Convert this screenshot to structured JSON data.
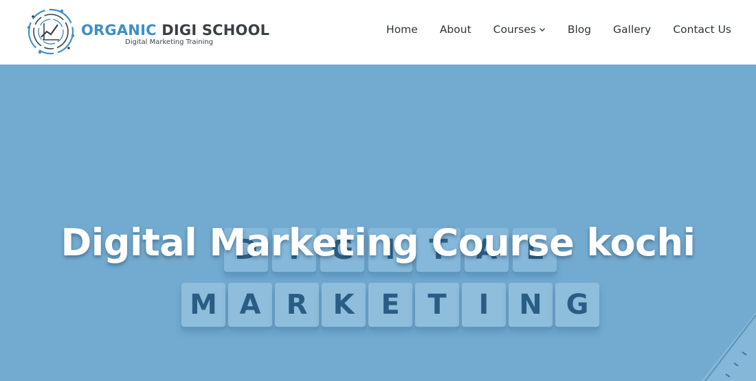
{
  "header": {
    "brand_part1": "ORGANIC",
    "brand_part2": "DIGI SCHOOL",
    "tagline": "Digital Marketing Training",
    "logo_icon": "circuit-chart-logo-icon",
    "nav": [
      {
        "label": "Home"
      },
      {
        "label": "About"
      },
      {
        "label": "Courses",
        "icon": "chevron-down-icon"
      },
      {
        "label": "Blog"
      },
      {
        "label": "Gallery"
      },
      {
        "label": "Contact Us"
      }
    ]
  },
  "hero": {
    "title": "Digital Marketing Course kochi",
    "tiles_top": [
      "D",
      "I",
      "G",
      "I",
      "T",
      "A",
      "L"
    ],
    "tiles_bottom": [
      "M",
      "A",
      "R",
      "K",
      "E",
      "T",
      "I",
      "N",
      "G"
    ],
    "overlay_color": "#73abd0"
  },
  "colors": {
    "brand_blue": "#3d8fc6",
    "brand_dark": "#3a3f44",
    "nav_text": "#2e3438"
  }
}
